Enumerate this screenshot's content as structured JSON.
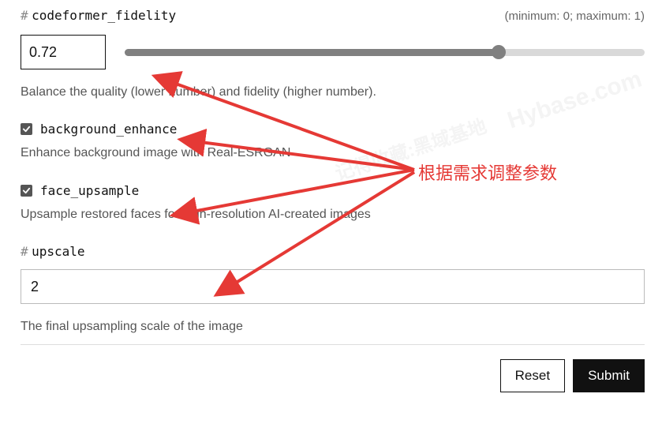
{
  "fidelity": {
    "prefix": "#",
    "name": "codeformer_fidelity",
    "range_hint": "(minimum: 0; maximum: 1)",
    "value": "0.72",
    "slider_percent": 72,
    "desc": "Balance the quality (lower number) and fidelity (higher number)."
  },
  "bg_enhance": {
    "checked": true,
    "name": "background_enhance",
    "desc": "Enhance background image with Real-ESRGAN"
  },
  "face_upsample": {
    "checked": true,
    "name": "face_upsample",
    "desc": "Upsample restored faces for high-resolution AI-created images"
  },
  "upscale": {
    "prefix": "#",
    "name": "upscale",
    "value": "2",
    "desc": "The final upsampling scale of the image"
  },
  "actions": {
    "reset": "Reset",
    "submit": "Submit"
  },
  "annotation": {
    "label": "根据需求调整参数"
  },
  "watermark": {
    "en": "Hybase.com",
    "cn": "记得收藏:黑域基地"
  }
}
